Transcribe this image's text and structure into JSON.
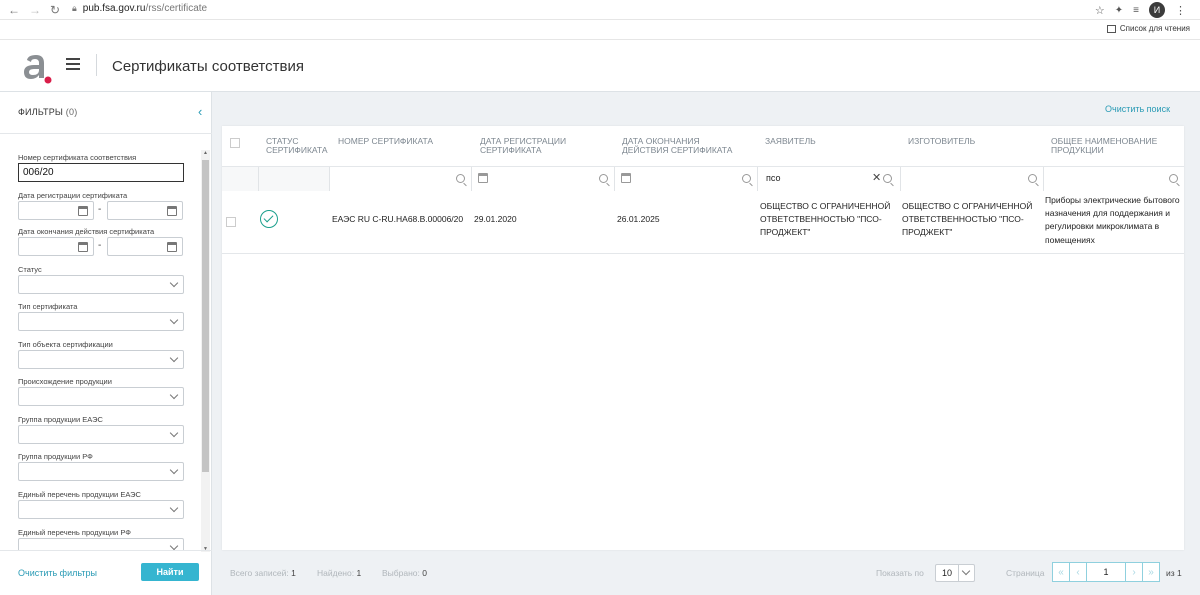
{
  "browser": {
    "url": "pub.fsa.gov.ru/rss/certificate",
    "url_host": "pub.fsa.gov.ru",
    "url_path": "/rss/certificate",
    "avatar_letter": "И",
    "reading_list": "Список для чтения"
  },
  "header": {
    "title": "Сертификаты соответствия"
  },
  "sidebar": {
    "title": "ФИЛЬТРЫ",
    "count": "(0)",
    "filters": {
      "cert_number_label": "Номер сертификата соответствия",
      "cert_number_value": "006/20",
      "reg_date_label": "Дата регистрации сертификата",
      "end_date_label": "Дата окончания действия сертификата",
      "date_separator": "-",
      "status_label": "Статус",
      "cert_type_label": "Тип сертификата",
      "object_type_label": "Тип объекта сертификации",
      "origin_label": "Происхождение продукции",
      "group_eaes_label": "Группа продукции ЕАЭС",
      "group_rf_label": "Группа продукции РФ",
      "list_eaes_label": "Единый перечень продукции ЕАЭС",
      "list_rf_label": "Единый перечень продукции РФ"
    },
    "clear_label": "Очистить фильтры",
    "find_label": "Найти"
  },
  "main": {
    "clear_search": "Очистить поиск",
    "columns": [
      "СТАТУС СЕРТИФИКАТА",
      "НОМЕР СЕРТИФИКАТА",
      "ДАТА РЕГИСТРАЦИИ СЕРТИФИКАТА",
      "ДАТА ОКОНЧАНИЯ ДЕЙСТВИЯ СЕРТИФИКАТА",
      "ЗАЯВИТЕЛЬ",
      "ИЗГОТОВИТЕЛЬ",
      "ОБЩЕЕ НАИМЕНОВАНИЕ ПРОДУКЦИИ"
    ],
    "applicant_filter": "псо",
    "rows": [
      {
        "status": "active",
        "number": "ЕАЭС RU C-RU.НА68.В.00006/20",
        "reg_date": "29.01.2020",
        "end_date": "26.01.2025",
        "applicant": "ОБЩЕСТВО С ОГРАНИЧЕННОЙ ОТВЕТСТВЕННОСТЬЮ \"ПСО-ПРОДЖЕКТ\"",
        "manufacturer": "ОБЩЕСТВО С ОГРАНИЧЕННОЙ ОТВЕТСТВЕННОСТЬЮ \"ПСО-ПРОДЖЕКТ\"",
        "product": "Приборы электрические бытового назначения для поддержания и регулировки микроклимата в помещениях"
      }
    ]
  },
  "footer": {
    "total_label": "Всего записей:",
    "total_value": "1",
    "found_label": "Найдено:",
    "found_value": "1",
    "selected_label": "Выбрано:",
    "selected_value": "0",
    "show_label": "Показать по",
    "per_page": "10",
    "page_label": "Страница",
    "page_value": "1",
    "of_pages": "из 1"
  },
  "colors": {
    "accent": "#35b5d0",
    "link": "#2a9bb5",
    "status_ok": "#1a9f8c",
    "logo_dot": "#d91e4a"
  }
}
